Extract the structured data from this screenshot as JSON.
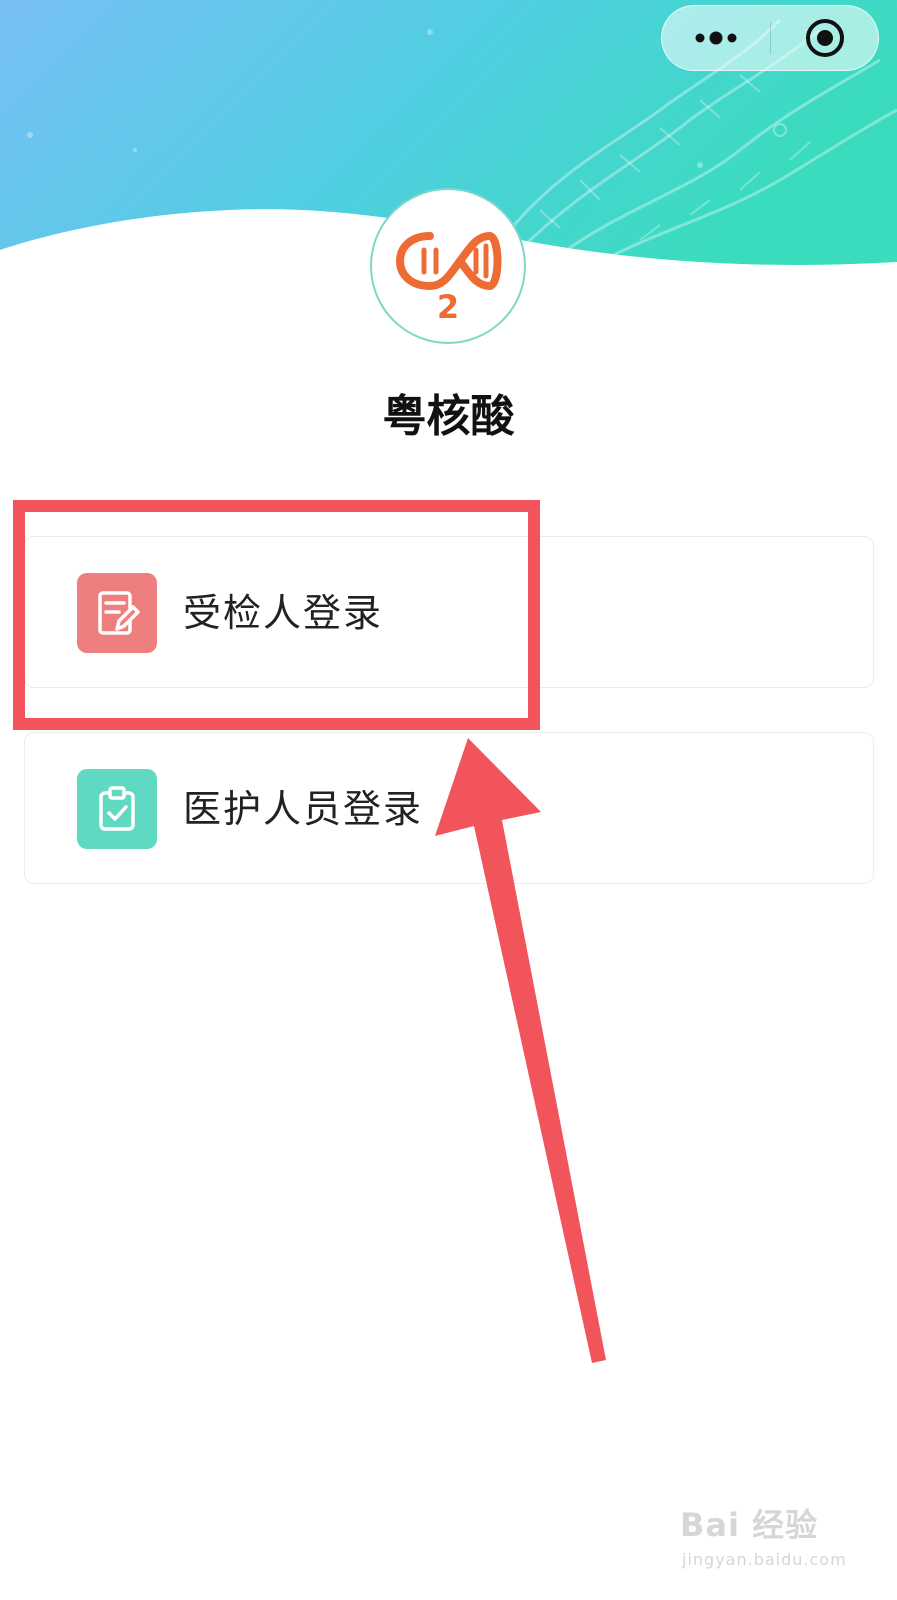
{
  "header": {
    "capsule": {
      "more_icon": "more-dots-icon",
      "close_icon": "target-circle-icon"
    }
  },
  "app": {
    "logo_icon": "dna-o2-logo",
    "logo_text": "2",
    "title": "粤核酸"
  },
  "login_options": [
    {
      "label": "受检人登录",
      "icon": "document-edit-icon",
      "color": "#ef7f7f"
    },
    {
      "label": "医护人员登录",
      "icon": "clipboard-check-icon",
      "color": "#5fd9c2"
    }
  ],
  "annotation": {
    "highlight_color": "#f2545b"
  },
  "watermark": {
    "main": "Bai 经验",
    "sub": "jingyan.baidu.com"
  },
  "colors": {
    "header_gradient_start": "#7ec3f5",
    "header_gradient_end": "#3fdcc0",
    "brand_orange": "#ef6b34"
  }
}
